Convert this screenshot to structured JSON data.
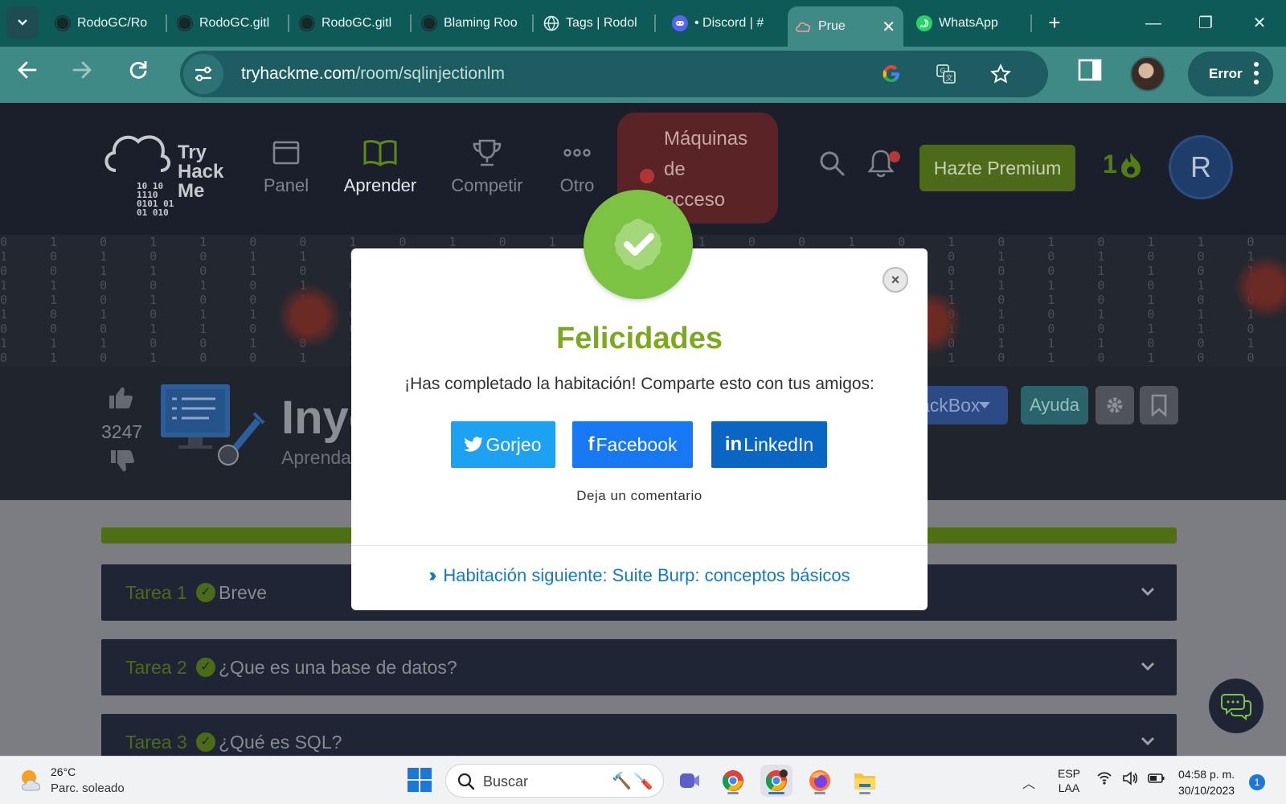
{
  "browser": {
    "tabs": [
      {
        "label": "RodoGC/Ro",
        "favicon": "github-icon"
      },
      {
        "label": "RodoGC.gitl",
        "favicon": "github-icon"
      },
      {
        "label": "RodoGC.gitl",
        "favicon": "github-icon"
      },
      {
        "label": "Blaming Roo",
        "favicon": "github-icon"
      },
      {
        "label": "Tags | Rodol",
        "favicon": "globe-icon"
      },
      {
        "label": "• Discord | #",
        "favicon": "discord-icon"
      },
      {
        "label": "Prue",
        "favicon": "tryhackme-icon",
        "active": true
      },
      {
        "label": "WhatsApp",
        "favicon": "whatsapp-icon"
      }
    ],
    "new_tab": "+",
    "url_domain": "tryhackme.com",
    "url_path": "/room/sqlinjectionlm",
    "profile_error": "Error"
  },
  "site": {
    "logo": {
      "line1": "Try",
      "line2": "Hack",
      "line3": "Me",
      "bits": [
        "10  10",
        "1110",
        "0101 01",
        "01 010"
      ]
    },
    "nav": [
      {
        "label": "Panel",
        "icon": "dashboard-icon"
      },
      {
        "label": "Aprender",
        "icon": "book-icon",
        "active": true
      },
      {
        "label": "Competir",
        "icon": "trophy-icon"
      },
      {
        "label": "Otro",
        "icon": "ellipsis-icon"
      }
    ],
    "machines_label": {
      "line1": "Máquinas",
      "line2": "de",
      "line3": "acceso"
    },
    "premium_button": "Hazte Premium",
    "streak_count": "1",
    "avatar_initial": "R",
    "room": {
      "votes": "3247",
      "title": "Inye",
      "subtitle": "Aprenda",
      "attackbox_label": "ackBox",
      "help_label": "Ayuda"
    },
    "progress_fraction": 1.0,
    "tasks": [
      {
        "num": "Tarea 1",
        "title": "Breve"
      },
      {
        "num": "Tarea 2",
        "title": "¿Que es una base de datos?"
      },
      {
        "num": "Tarea 3",
        "title": "¿Qué es SQL?"
      }
    ]
  },
  "modal": {
    "title": "Felicidades",
    "message": "¡Has completado la habitación! Comparte esto con tus amigos:",
    "share": {
      "twitter": "Gorjeo",
      "facebook": "Facebook",
      "linkedin": "LinkedIn"
    },
    "comment_link": "Deja un comentario",
    "next_room": "Habitación siguiente: Suite Burp: conceptos básicos",
    "close": "×"
  },
  "taskbar": {
    "temperature": "26°C",
    "weather": "Parc. soleado",
    "search_placeholder": "Buscar",
    "lang_line1": "ESP",
    "lang_line2": "LAA",
    "time": "04:58 p. m.",
    "date": "30/10/2023",
    "notifications": "1"
  },
  "colors": {
    "tab_strip": "#0e5a58",
    "toolbar": "#3f8a86",
    "felicidades_green": "#7caa1c",
    "badge_green": "#7cc243",
    "twitter_blue": "#1da1f2",
    "facebook_blue": "#1877f2",
    "linkedin_blue": "#0a66c2",
    "link_blue": "#1677c9"
  }
}
